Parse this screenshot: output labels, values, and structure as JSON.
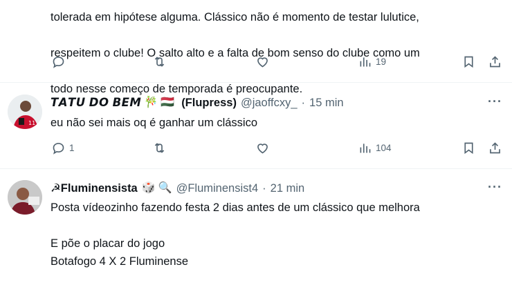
{
  "tweet1": {
    "text_lines": [
      "tolerada em hipótese alguma. Clássico não é momento de testar lulutice,",
      "respeitem o clube! O salto alto e a falta de bom senso do clube como um",
      "todo nesse começo de temporada é preocupante."
    ],
    "reply_count": "",
    "retweet_count": "",
    "like_count": "",
    "view_count": "19"
  },
  "tweet2": {
    "name": "𝙏𝘼𝙏𝙐 𝘿𝙊 𝘽𝙀𝙈",
    "emoji1": "🎋",
    "emoji2": "🇭🇺",
    "affiliation": "(Flupress)",
    "handle": "@jaoffcxy_",
    "separator": "·",
    "time": "15 min",
    "text": "eu não sei mais oq é ganhar um clássico",
    "reply_count": "1",
    "retweet_count": "",
    "like_count": "",
    "view_count": "104"
  },
  "tweet3": {
    "prefix_emoji": "☭",
    "name": "Fluminensista",
    "emoji1": "🎲",
    "emoji2": "🔍",
    "handle": "@Fluminensist4",
    "separator": "·",
    "time": "21 min",
    "text": "Posta vídeozinho fazendo festa 2 dias antes de um clássico que melhora\n\nE põe o placar do jogo\nBotafogo 4 X 2 Fluminense"
  },
  "icons": {
    "more": "more-horizontal-icon",
    "reply": "reply-bubble-icon",
    "retweet": "retweet-icon",
    "like": "heart-icon",
    "views": "bar-chart-icon",
    "bookmark": "bookmark-icon",
    "share": "share-icon"
  },
  "colors": {
    "text": "#0f1419",
    "secondary": "#536471",
    "divider": "#eff3f4"
  }
}
